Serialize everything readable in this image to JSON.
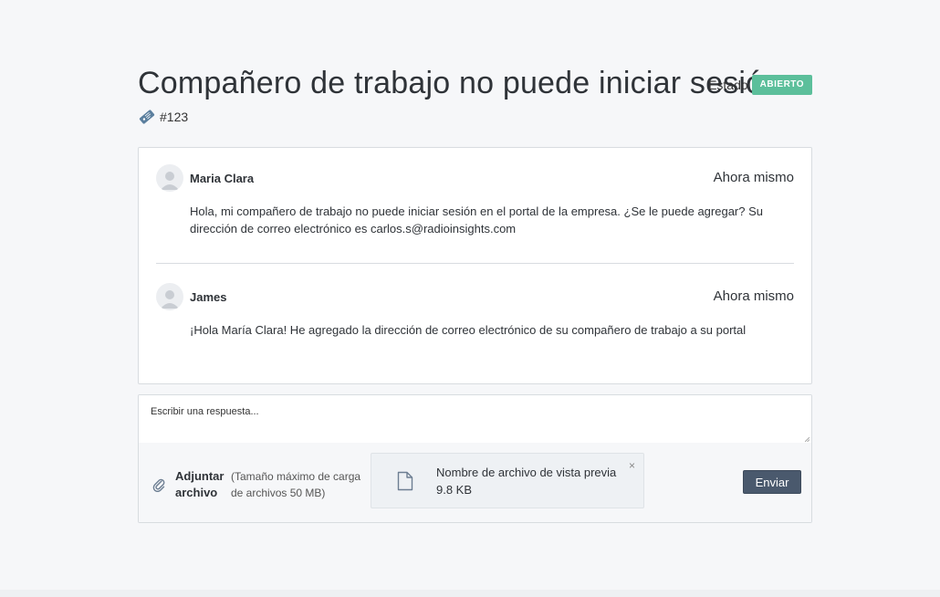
{
  "ticket": {
    "title": "Compañero de trabajo no puede iniciar sesión",
    "number": "#123",
    "status_label": "Estado",
    "status_value": "ABIERTO",
    "status_color": "#5cbf9b"
  },
  "messages": [
    {
      "author": "Maria Clara",
      "time": "Ahora mismo",
      "text": "Hola, mi compañero de trabajo no puede iniciar sesión en el portal de la empresa. ¿Se le puede agregar? Su dirección de correo electrónico es carlos.s@radioinsights.com"
    },
    {
      "author": "James",
      "time": "Ahora mismo",
      "text": "¡Hola María Clara! He agregado la dirección de correo electrónico de su compañero de trabajo a su portal"
    }
  ],
  "composer": {
    "placeholder": "Escribir una respuesta...",
    "attach_label": "Adjuntar archivo",
    "attach_note": "(Tamaño máximo de carga de archivos 50 MB)",
    "file_name": "Nombre de archivo de vista previa",
    "file_size": "9.8 KB",
    "close_glyph": "×",
    "send_label": "Enviar",
    "send_color": "#4a596d"
  },
  "icons": {
    "ticket": "ticket-icon",
    "avatar": "user-avatar-icon",
    "attach": "paperclip-icon",
    "file": "document-icon",
    "close": "close-icon"
  }
}
